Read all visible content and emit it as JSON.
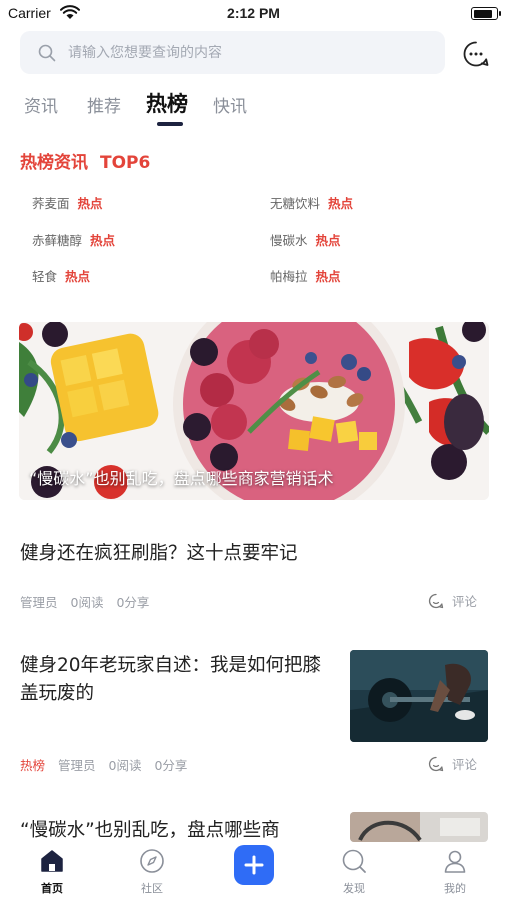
{
  "status_bar": {
    "carrier": "Carrier",
    "time": "2:12 PM",
    "battery_level": 0.9
  },
  "search": {
    "placeholder": "请输入您想要查询的内容"
  },
  "tabs": [
    {
      "label": "资讯",
      "active": false
    },
    {
      "label": "推荐",
      "active": false
    },
    {
      "label": "热榜",
      "active": true
    },
    {
      "label": "快讯",
      "active": false
    }
  ],
  "hot_section": {
    "title": "热榜资讯",
    "rank_label": "TOP6",
    "items": [
      {
        "name": "荞麦面",
        "tag": "热点"
      },
      {
        "name": "无糖饮料",
        "tag": "热点"
      },
      {
        "name": "赤藓糖醇",
        "tag": "热点"
      },
      {
        "name": "慢碳水",
        "tag": "热点"
      },
      {
        "name": "轻食",
        "tag": "热点"
      },
      {
        "name": "帕梅拉",
        "tag": "热点"
      }
    ]
  },
  "banner": {
    "caption": "“慢碳水”也别乱吃，盘点哪些商家营销话术"
  },
  "articles": [
    {
      "title": "健身还在疯狂刷脂？这十点要牢记",
      "author": "管理员",
      "reads": "0阅读",
      "shares": "0分享",
      "comment_label": "评论"
    },
    {
      "title": "健身20年老玩家自述：我是如何把膝盖玩废的",
      "hot_tag": "热榜",
      "author": "管理员",
      "reads": "0阅读",
      "shares": "0分享",
      "comment_label": "评论"
    },
    {
      "title": "“慢碳水”也别乱吃，盘点哪些商"
    }
  ],
  "tabbar": {
    "items": [
      {
        "label": "首页",
        "icon": "home-icon",
        "active": true
      },
      {
        "label": "社区",
        "icon": "compass-icon",
        "active": false
      },
      {
        "label": "",
        "icon": "plus-icon",
        "active": false
      },
      {
        "label": "发现",
        "icon": "discover-icon",
        "active": false
      },
      {
        "label": "我的",
        "icon": "profile-icon",
        "active": false
      }
    ]
  },
  "colors": {
    "accent_red": "#e3443a",
    "accent_blue": "#2f6cf6",
    "tab_underline": "#1d2340"
  }
}
